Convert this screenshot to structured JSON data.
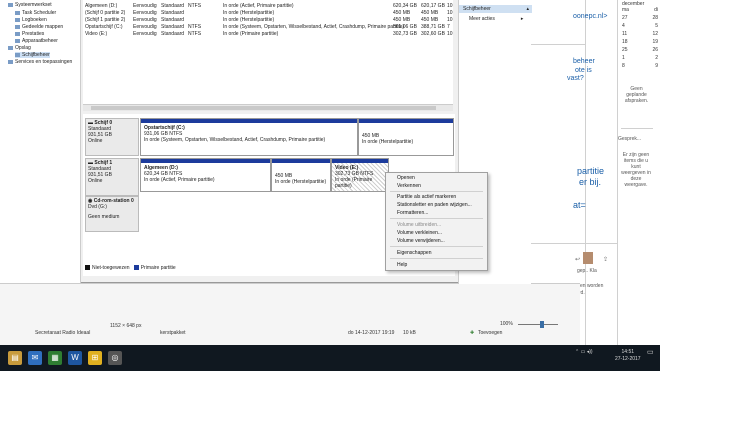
{
  "tree": {
    "items": [
      {
        "label": "Systeemwerkset"
      },
      {
        "label": "Task Scheduler"
      },
      {
        "label": "Logboeken"
      },
      {
        "label": "Gedeelde mappen"
      },
      {
        "label": "Prestaties"
      },
      {
        "label": "Apparaatbeheer"
      },
      {
        "label": "Opslag"
      },
      {
        "label": "Schijfbeheer"
      },
      {
        "label": "Services en toepassingen"
      }
    ]
  },
  "volume_list": {
    "rows": [
      {
        "name": "Algemeen (D:)",
        "layout": "Eenvoudig",
        "type": "Standaard",
        "fs": "NTFS",
        "status": "In orde (Actief, Primaire partitie)",
        "cap": "620,34 GB",
        "free": "620,17 GB",
        "pct": "10"
      },
      {
        "name": "(Schijf 0 partitie 2)",
        "layout": "Eenvoudig",
        "type": "Standaard",
        "fs": "",
        "status": "In orde (Herstelpartitie)",
        "cap": "450 MB",
        "free": "450 MB",
        "pct": "10"
      },
      {
        "name": "(Schijf 1 partitie 2)",
        "layout": "Eenvoudig",
        "type": "Standaard",
        "fs": "",
        "status": "In orde (Herstelpartitie)",
        "cap": "450 MB",
        "free": "450 MB",
        "pct": "10"
      },
      {
        "name": "Opstartschijf (C:)",
        "layout": "Eenvoudig",
        "type": "Standaard",
        "fs": "NTFS",
        "status": "In orde (Systeem, Opstarten, Wisselbestand, Actief, Crashdump, Primaire partitie)",
        "cap": "501,06 GB",
        "free": "388,71 GB",
        "pct": "7"
      },
      {
        "name": "Video (E:)",
        "layout": "Eenvoudig",
        "type": "Standaard",
        "fs": "NTFS",
        "status": "In orde (Primaire partitie)",
        "cap": "302,73 GB",
        "free": "302,60 GB",
        "pct": "10"
      }
    ]
  },
  "disks": {
    "disk0": {
      "name": "Schijf 0",
      "type": "Standaard",
      "size": "931,51 GB",
      "state": "Online",
      "p1_title": "Opstartschijf (C:)",
      "p1_size": "931,06 GB NTFS",
      "p1_status": "In orde (Systeem, Opstarten, Wisselbestand, Actief, Crashdump, Primaire partitie)",
      "p2_size": "450 MB",
      "p2_status": "In orde (Herstelpartitie)"
    },
    "disk1": {
      "name": "Schijf 1",
      "type": "Standaard",
      "size": "931,51 GB",
      "state": "Online",
      "p1_title": "Algemeen (D:)",
      "p1_size": "620,34 GB NTFS",
      "p1_status": "In orde (Actief, Primaire partitie)",
      "p2_size": "450 MB",
      "p2_status": "In orde (Herstelpartitie)",
      "p3_title": "Video (E:)",
      "p3_size": "302,73 GB NTFS",
      "p3_status": "In orde (Primaire partitie)"
    },
    "cd": {
      "name": "Cd-rom-station 0",
      "type": "Dvd (G:)",
      "state": "Geen medium"
    }
  },
  "legend": {
    "unallocated": "Niet-toegewezen",
    "primary": "Primaire partitie"
  },
  "actions": {
    "header": "Schijfbeheer",
    "more": "Meer acties"
  },
  "context_menu": {
    "items": [
      {
        "label": "Openen",
        "enabled": true
      },
      {
        "label": "Verkennen",
        "enabled": true
      },
      {
        "label": "Partitie als actief markeren",
        "enabled": true
      },
      {
        "label": "Stationsletter en paden wijzigen...",
        "enabled": true
      },
      {
        "label": "Formatteren...",
        "enabled": true
      },
      {
        "label": "Volume uitbreiden...",
        "enabled": false
      },
      {
        "label": "Volume verkleinen...",
        "enabled": true
      },
      {
        "label": "Volume verwijderen...",
        "enabled": true
      },
      {
        "label": "Eigenschappen",
        "enabled": true
      },
      {
        "label": "Help",
        "enabled": true
      }
    ]
  },
  "background": {
    "link1": "oonepc.nl>",
    "link2a": "beheer",
    "link2b": "ote is",
    "link2c": "vast?",
    "big1": "partitie",
    "big2": "er bij.",
    "big3": "at=",
    "no_appts": "Geen geplande afspraken.",
    "gesprek": "Gesprek...",
    "no_items": "Er zijn geen items die u kunt weergeven in deze weergave.",
    "side_text1": "gep.. Kla",
    "side_text2": "ssen worden",
    "side_text3": "ierd."
  },
  "calendar": {
    "month": "december",
    "rows": [
      [
        "ma",
        "di"
      ],
      [
        "27",
        "28"
      ],
      [
        "4",
        "5"
      ],
      [
        "11",
        "12"
      ],
      [
        "18",
        "19"
      ],
      [
        "25",
        "26"
      ],
      [
        "1",
        "2"
      ],
      [
        "8",
        "9"
      ]
    ]
  },
  "explorer": {
    "dims": "1152 × 648 px",
    "file_name": "Secretaraat Radio Ideaal",
    "file_type": "kerstpakket",
    "file_date": "do 14-12-2017 19:19",
    "file_size": "10 kB",
    "add_label": "Toevoegen",
    "zoom": "100%"
  },
  "taskbar": {
    "time": "14:51",
    "date": "27-12-2017"
  }
}
